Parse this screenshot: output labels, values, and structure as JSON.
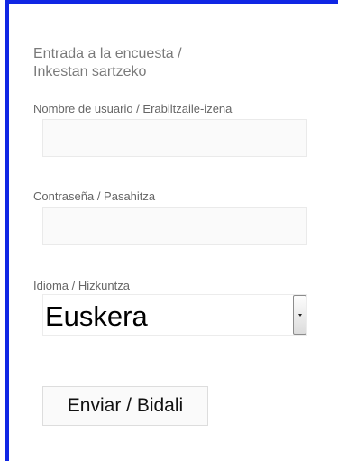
{
  "form": {
    "title_line1": "Entrada a la encuesta /",
    "title_line2": "Inkestan sartzeko",
    "username_label": "Nombre de usuario / Erabiltzaile-izena",
    "username_value": "",
    "password_label": "Contraseña / Pasahitza",
    "password_value": "",
    "language_label": "Idioma / Hizkuntza",
    "language_selected": "Euskera",
    "submit_label": "Enviar / Bidali"
  },
  "icons": {
    "select_arrow": "chevron-down-icon"
  },
  "colors": {
    "frame_border": "#0f26e4"
  }
}
